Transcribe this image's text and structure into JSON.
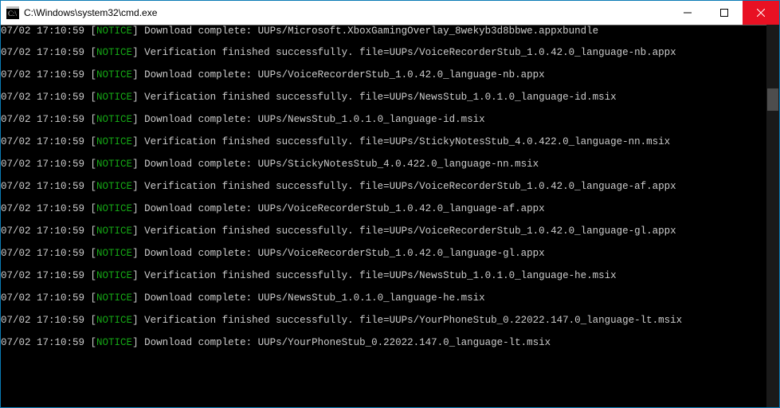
{
  "window": {
    "title": "C:\\Windows\\system32\\cmd.exe"
  },
  "scroll": {
    "thumbTop": 80,
    "thumbHeight": 28
  },
  "lines": [
    {
      "timestamp": "07/02 17:10:59",
      "level": "NOTICE",
      "message": "Download complete: UUPs/Microsoft.XboxGamingOverlay_8wekyb3d8bbwe.appxbundle"
    },
    {
      "blank": true
    },
    {
      "timestamp": "07/02 17:10:59",
      "level": "NOTICE",
      "message": "Verification finished successfully. file=UUPs/VoiceRecorderStub_1.0.42.0_language-nb.appx"
    },
    {
      "blank": true
    },
    {
      "timestamp": "07/02 17:10:59",
      "level": "NOTICE",
      "message": "Download complete: UUPs/VoiceRecorderStub_1.0.42.0_language-nb.appx"
    },
    {
      "blank": true
    },
    {
      "timestamp": "07/02 17:10:59",
      "level": "NOTICE",
      "message": "Verification finished successfully. file=UUPs/NewsStub_1.0.1.0_language-id.msix"
    },
    {
      "blank": true
    },
    {
      "timestamp": "07/02 17:10:59",
      "level": "NOTICE",
      "message": "Download complete: UUPs/NewsStub_1.0.1.0_language-id.msix"
    },
    {
      "blank": true
    },
    {
      "timestamp": "07/02 17:10:59",
      "level": "NOTICE",
      "message": "Verification finished successfully. file=UUPs/StickyNotesStub_4.0.422.0_language-nn.msix"
    },
    {
      "blank": true
    },
    {
      "timestamp": "07/02 17:10:59",
      "level": "NOTICE",
      "message": "Download complete: UUPs/StickyNotesStub_4.0.422.0_language-nn.msix"
    },
    {
      "blank": true
    },
    {
      "timestamp": "07/02 17:10:59",
      "level": "NOTICE",
      "message": "Verification finished successfully. file=UUPs/VoiceRecorderStub_1.0.42.0_language-af.appx"
    },
    {
      "blank": true
    },
    {
      "timestamp": "07/02 17:10:59",
      "level": "NOTICE",
      "message": "Download complete: UUPs/VoiceRecorderStub_1.0.42.0_language-af.appx"
    },
    {
      "blank": true
    },
    {
      "timestamp": "07/02 17:10:59",
      "level": "NOTICE",
      "message": "Verification finished successfully. file=UUPs/VoiceRecorderStub_1.0.42.0_language-gl.appx"
    },
    {
      "blank": true
    },
    {
      "timestamp": "07/02 17:10:59",
      "level": "NOTICE",
      "message": "Download complete: UUPs/VoiceRecorderStub_1.0.42.0_language-gl.appx"
    },
    {
      "blank": true
    },
    {
      "timestamp": "07/02 17:10:59",
      "level": "NOTICE",
      "message": "Verification finished successfully. file=UUPs/NewsStub_1.0.1.0_language-he.msix"
    },
    {
      "blank": true
    },
    {
      "timestamp": "07/02 17:10:59",
      "level": "NOTICE",
      "message": "Download complete: UUPs/NewsStub_1.0.1.0_language-he.msix"
    },
    {
      "blank": true
    },
    {
      "timestamp": "07/02 17:10:59",
      "level": "NOTICE",
      "message": "Verification finished successfully. file=UUPs/YourPhoneStub_0.22022.147.0_language-lt.msix"
    },
    {
      "blank": true
    },
    {
      "timestamp": "07/02 17:10:59",
      "level": "NOTICE",
      "message": "Download complete: UUPs/YourPhoneStub_0.22022.147.0_language-lt.msix"
    },
    {
      "blank": true
    }
  ]
}
